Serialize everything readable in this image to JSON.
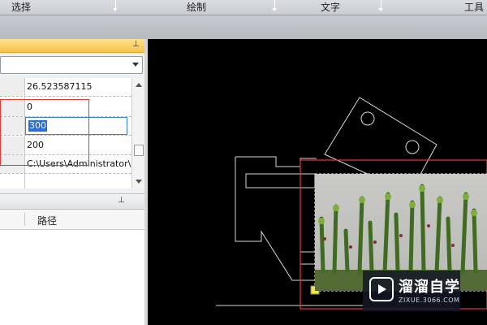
{
  "toolbar": {
    "tabs": [
      "选择",
      "绘制",
      "文字",
      "工具"
    ]
  },
  "properties": {
    "rows": [
      {
        "value": "26.523587115"
      },
      {
        "value": "0"
      },
      {
        "value": "300"
      },
      {
        "value": "200"
      },
      {
        "value": "C:\\Users\\Administrator\\"
      }
    ]
  },
  "file_panel": {
    "column_path": "路径"
  },
  "watermark": {
    "title": "溜溜自学",
    "subtitle": "ZIXUE.3066.COM"
  },
  "colors": {
    "panel_header": "#f7c34a",
    "selection_box": "#e53935",
    "edit_highlight": "#2a6fd6",
    "canvas_bg": "#000000"
  }
}
